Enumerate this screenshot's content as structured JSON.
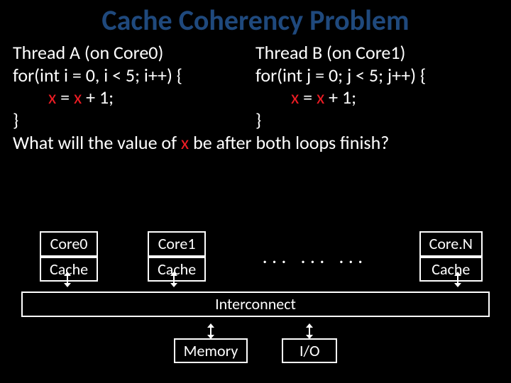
{
  "title": "Cache Coherency Problem",
  "threadA": {
    "header": "Thread A (on Core0)",
    "for": "for(int i = 0, i < 5; i++) {",
    "body_pre": "x",
    "body_mid": " = ",
    "body_post": " + 1;",
    "close": "}"
  },
  "threadB": {
    "header": "Thread B (on Core1)",
    "for": "for(int j = 0; j < 5; j++) {",
    "body_pre": "x",
    "body_mid": " = ",
    "body_post": " + 1;",
    "close": "}"
  },
  "question_pre": "What will the value of ",
  "question_x": "x",
  "question_post": " be after both loops finish?",
  "cores": {
    "c0": "Core0",
    "c1": "Core1",
    "cn": "Core.N",
    "cache": "Cache"
  },
  "dots": ". . .",
  "interconnect": "Interconnect",
  "memory": "Memory",
  "io": "I/O"
}
